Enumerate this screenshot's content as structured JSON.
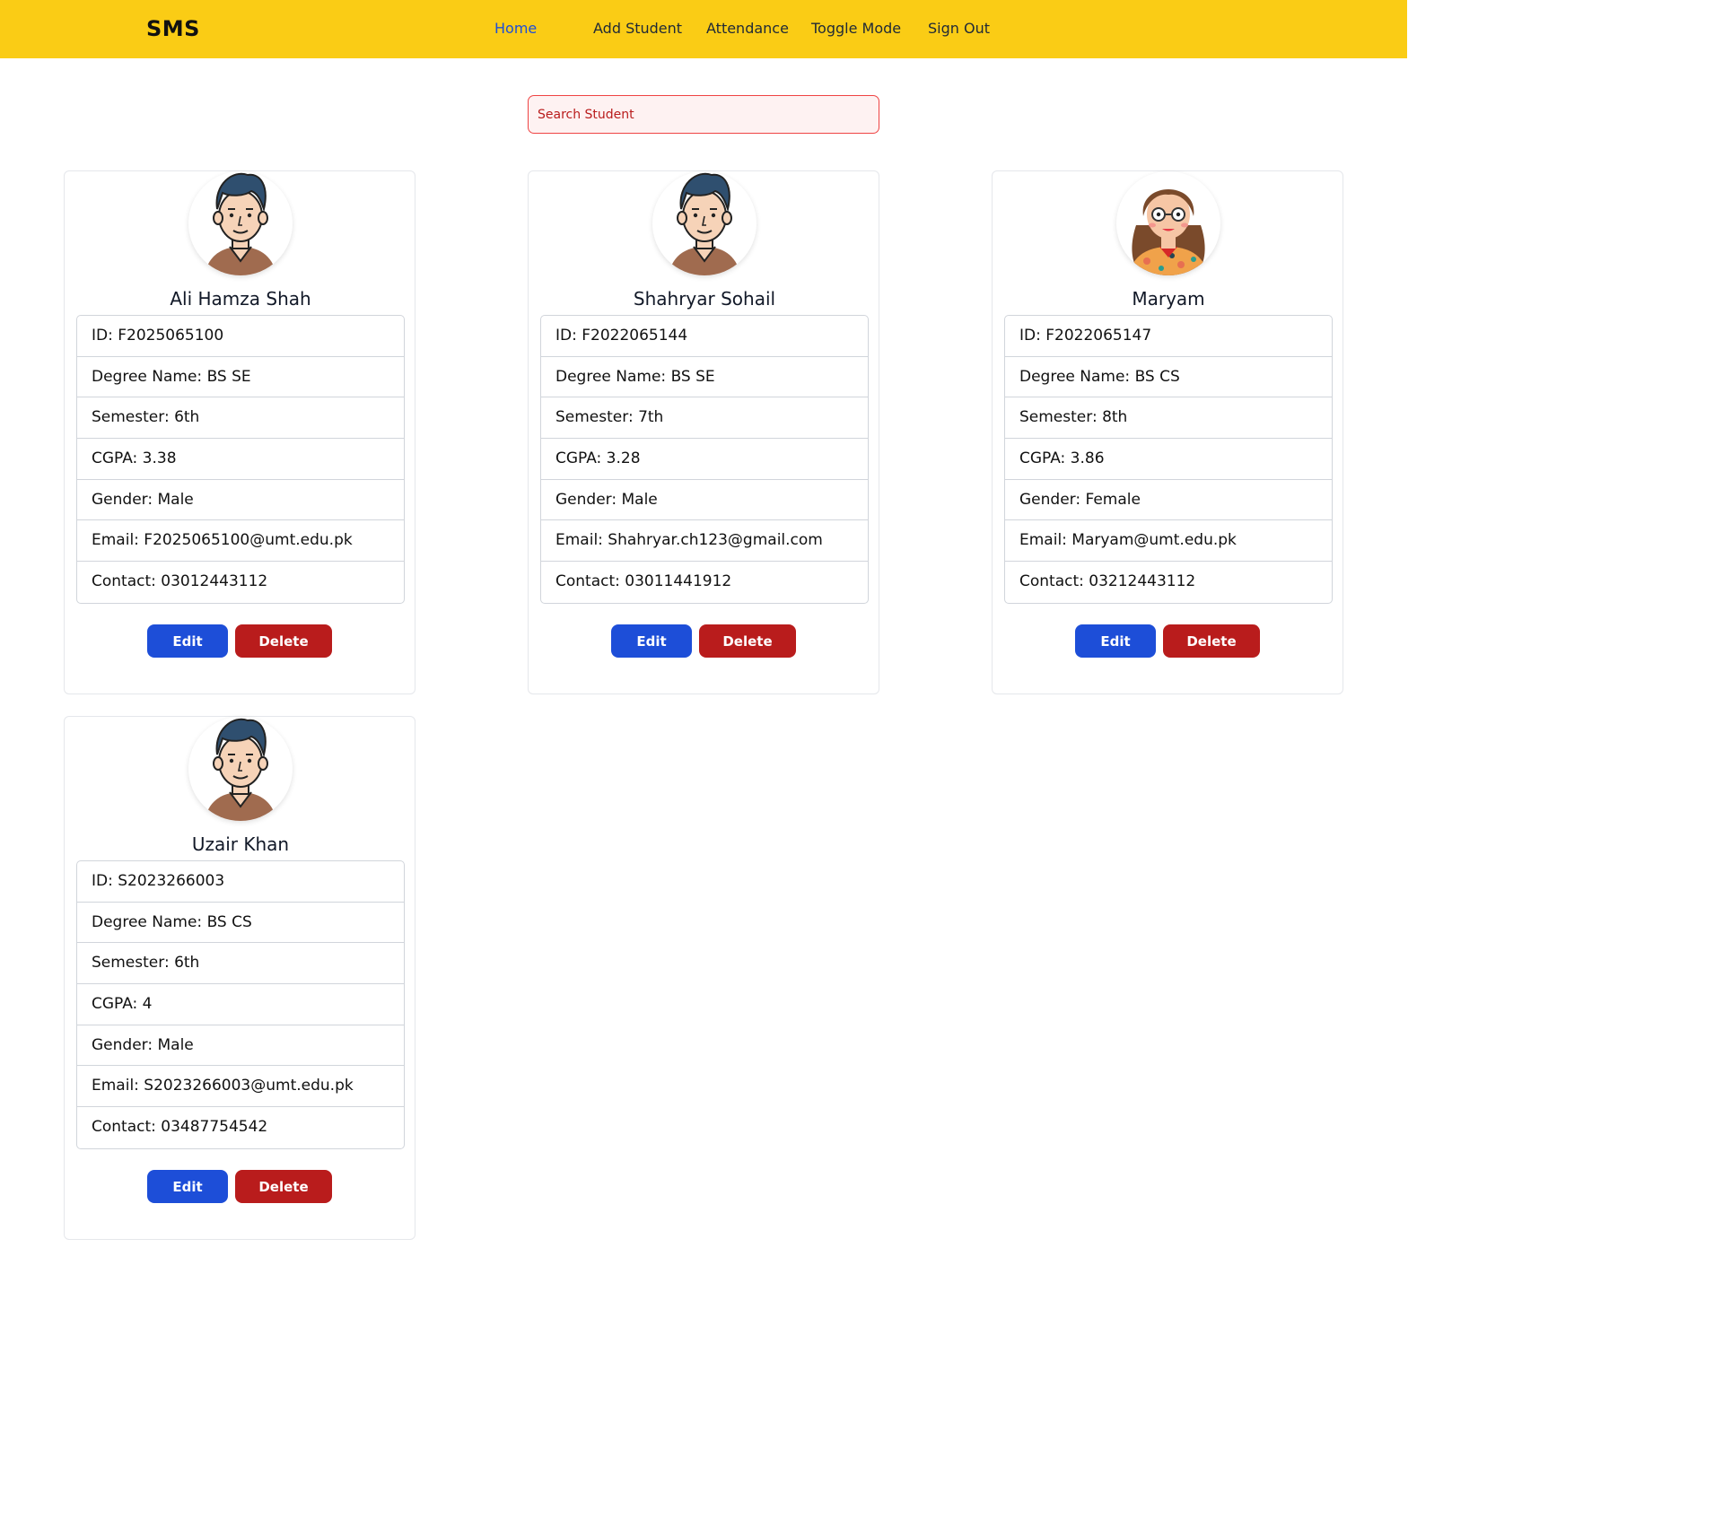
{
  "navbar": {
    "brand": "SMS",
    "links": [
      "Home",
      "Add Student",
      "Attendance",
      "Toggle Mode",
      "Sign Out"
    ],
    "active": "Home",
    "bg_color": "#facc15",
    "active_color": "#1d4ed8"
  },
  "search": {
    "placeholder": "Search Student",
    "value": ""
  },
  "students": [
    {
      "name": "Ali Hamza Shah",
      "avatar": "male-avatar-icon",
      "fields": [
        "ID: F2025065100",
        "Degree Name: BS SE",
        "Semester: 6th",
        "CGPA: 3.38",
        "Gender: Male",
        "Email: F2025065100@umt.edu.pk",
        "Contact: 03012443112"
      ],
      "edit_label": "Edit",
      "delete_label": "Delete"
    },
    {
      "name": "Shahryar Sohail",
      "avatar": "male-avatar-icon",
      "fields": [
        "ID: F2022065144",
        "Degree Name: BS SE",
        "Semester: 7th",
        "CGPA: 3.28",
        "Gender: Male",
        "Email: Shahryar.ch123@gmail.com",
        "Contact: 03011441912"
      ],
      "edit_label": "Edit",
      "delete_label": "Delete"
    },
    {
      "name": "Maryam",
      "avatar": "female-avatar-icon",
      "fields": [
        "ID: F2022065147",
        "Degree Name: BS CS",
        "Semester: 8th",
        "CGPA: 3.86",
        "Gender: Female",
        "Email: Maryam@umt.edu.pk",
        "Contact: 03212443112"
      ],
      "edit_label": "Edit",
      "delete_label": "Delete"
    },
    {
      "name": "Uzair Khan",
      "avatar": "male-avatar-icon",
      "fields": [
        "ID: S2023266003",
        "Degree Name: BS CS",
        "Semester: 6th",
        "CGPA: 4",
        "Gender: Male",
        "Email: S2023266003@umt.edu.pk",
        "Contact: 03487754542"
      ],
      "edit_label": "Edit",
      "delete_label": "Delete"
    }
  ],
  "colors": {
    "edit_button": "#1d4ed8",
    "delete_button": "#b91c1c",
    "search_border": "#ef4444",
    "search_bg": "#fef2f2"
  }
}
